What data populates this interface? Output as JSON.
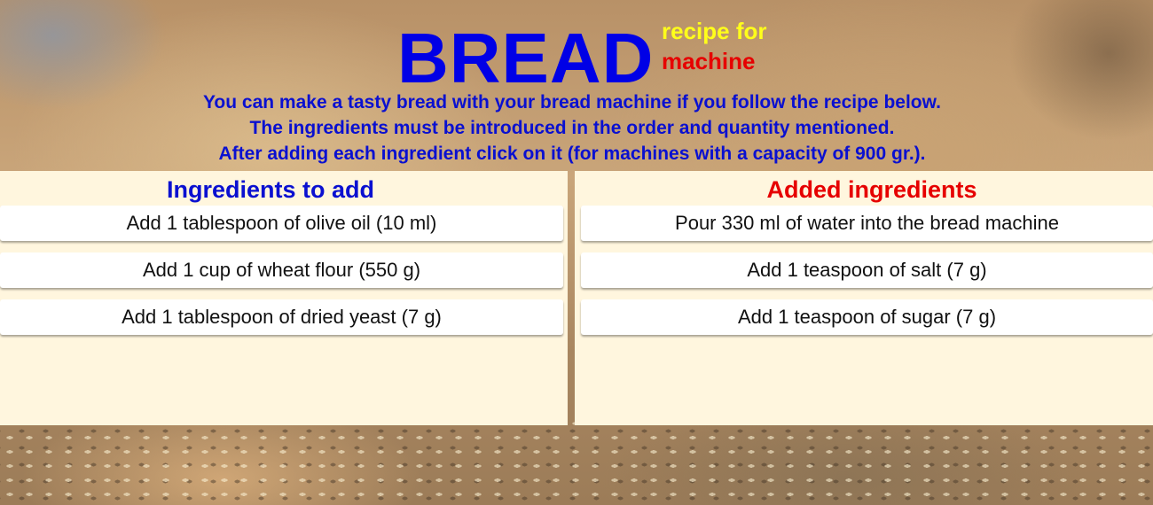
{
  "header": {
    "title": "BREAD",
    "subtitle_line1": "recipe for",
    "subtitle_line2": "machine",
    "intro_line1": "You can make a tasty bread with your bread machine if you follow the recipe below.",
    "intro_line2": "The ingredients must be introduced in the order and quantity mentioned.",
    "intro_line3": "After adding each ingredient click on it (for machines with a capacity of 900 gr.)."
  },
  "to_add": {
    "heading": "Ingredients to add",
    "items": [
      "Add 1 tablespoon of olive oil (10 ml)",
      "Add 1 cup of wheat flour (550 g)",
      "Add 1 tablespoon of dried yeast (7 g)"
    ]
  },
  "added": {
    "heading": "Added ingredients",
    "items": [
      "Pour 330 ml of water into the bread machine",
      "Add 1 teaspoon of salt (7 g)",
      "Add 1 teaspoon of sugar (7 g)"
    ]
  },
  "colors": {
    "title_blue": "#0000e6",
    "subtitle_yellow": "#ffff1a",
    "subtitle_red": "#e60000",
    "panel_bg": "#fff6de"
  }
}
